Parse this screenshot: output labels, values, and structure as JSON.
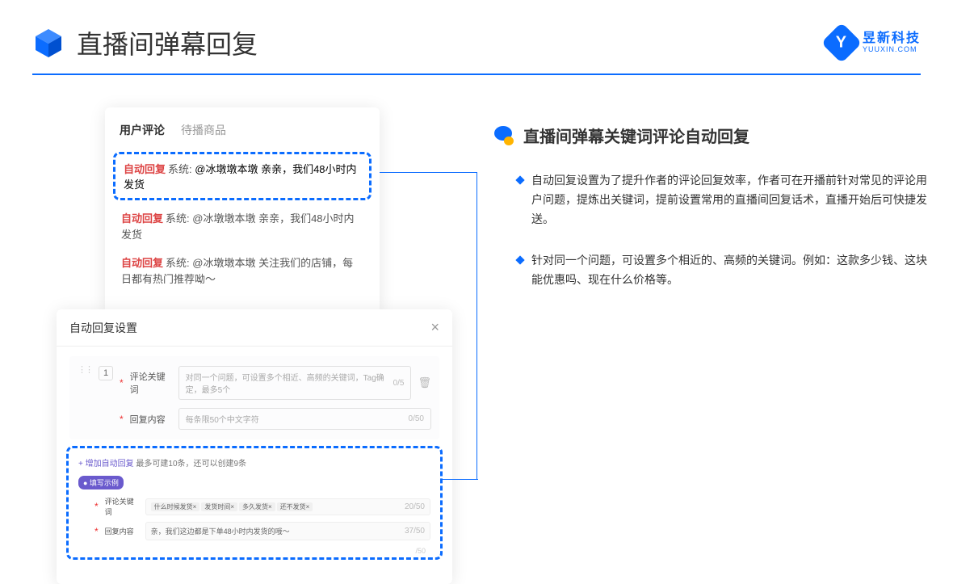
{
  "header": {
    "title": "直播间弹幕回复",
    "logo_cn": "昱新科技",
    "logo_en": "YUUXIN.COM"
  },
  "panelA": {
    "tab_active": "用户评论",
    "tab_inactive": "待播商品",
    "highlight": {
      "label": "自动回复",
      "sys": "系统:",
      "text": "@冰墩墩本墩 亲亲，我们48小时内发货"
    },
    "rows": [
      {
        "label": "自动回复",
        "sys": "系统:",
        "text": "@冰墩墩本墩 亲亲，我们48小时内发货"
      },
      {
        "label": "自动回复",
        "sys": "系统:",
        "text": "@冰墩墩本墩 关注我们的店铺，每日都有热门推荐呦～"
      }
    ]
  },
  "panelB": {
    "title": "自动回复设置",
    "index": "1",
    "row1": {
      "label": "评论关键词",
      "placeholder": "对同一个问题，可设置多个相近、高频的关键词，Tag确定，最多5个",
      "count": "0/5"
    },
    "row2": {
      "label": "回复内容",
      "placeholder": "每条限50个中文字符",
      "count": "0/50"
    },
    "add": {
      "link": "+ 增加自动回复",
      "hint": "最多可建10条，还可以创建9条"
    },
    "example_badge": "● 填写示例",
    "ex1": {
      "label": "评论关键词",
      "tags": [
        "什么时候发货×",
        "发货时间×",
        "多久发货×",
        "还不发货×"
      ],
      "count": "20/50"
    },
    "ex2": {
      "label": "回复内容",
      "text": "亲，我们这边都是下单48小时内发货的哦～",
      "count": "37/50"
    },
    "faint": "/50"
  },
  "right": {
    "title": "直播间弹幕关键词评论自动回复",
    "bullets": [
      "自动回复设置为了提升作者的评论回复效率，作者可在开播前针对常见的评论用户问题，提炼出关键词，提前设置常用的直播间回复话术，直播开始后可快捷发送。",
      "针对同一个问题，可设置多个相近的、高频的关键词。例如：这款多少钱、这块能优惠吗、现在什么价格等。"
    ]
  }
}
